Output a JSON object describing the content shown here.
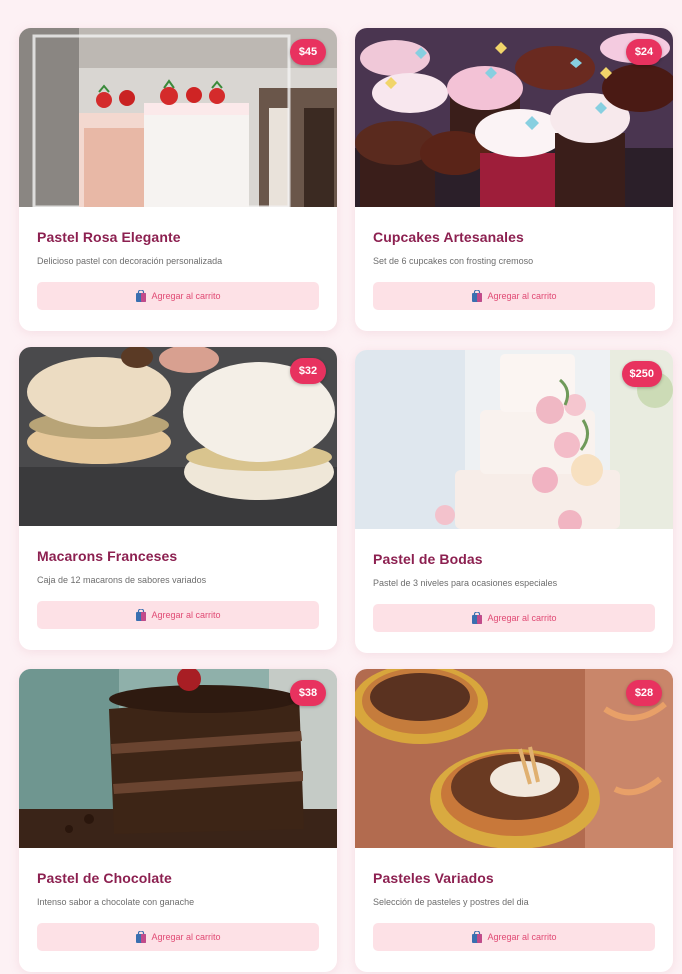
{
  "products": [
    {
      "title": "Pastel Rosa Elegante",
      "description": "Delicioso pastel con decoración personalizada",
      "price": "$45",
      "button_label": "Agregar al carrito",
      "image_icon": "strawberry-cake-photo"
    },
    {
      "title": "Cupcakes Artesanales",
      "description": "Set de 6 cupcakes con frosting cremoso",
      "price": "$24",
      "button_label": "Agregar al carrito",
      "image_icon": "cupcakes-photo"
    },
    {
      "title": "Macarons Franceses",
      "description": "Caja de 12 macarons de sabores variados",
      "price": "$32",
      "button_label": "Agregar al carrito",
      "image_icon": "macarons-photo"
    },
    {
      "title": "Pastel de Bodas",
      "description": "Pastel de 3 niveles para ocasiones especiales",
      "price": "$250",
      "button_label": "Agregar al carrito",
      "image_icon": "wedding-cake-photo"
    },
    {
      "title": "Pastel de Chocolate",
      "description": "Intenso sabor a chocolate con ganache",
      "price": "$38",
      "button_label": "Agregar al carrito",
      "image_icon": "chocolate-cake-photo"
    },
    {
      "title": "Pasteles Variados",
      "description": "Selección de pasteles y postres del dia",
      "price": "$28",
      "button_label": "Agregar al carrito",
      "image_icon": "tarts-photo"
    }
  ],
  "colors": {
    "page_background": "#fdf1f4",
    "title": "#8c2050",
    "price_badge": "#e8325f",
    "button_background": "#fde1e6",
    "button_text": "#e04a74"
  }
}
